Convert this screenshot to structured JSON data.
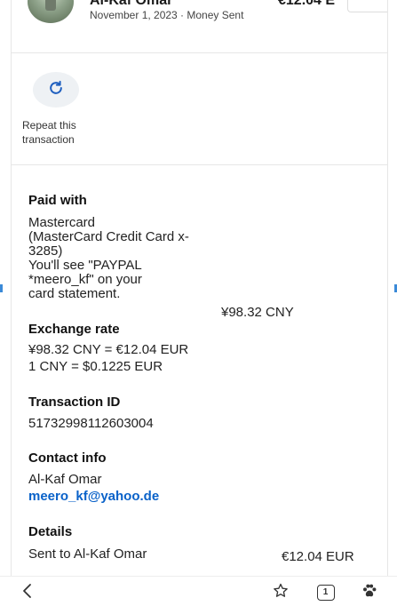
{
  "header": {
    "name": "Al-Kaf Omar",
    "amount": "€12.04 E",
    "subtitle": "November 1, 2023 · Money Sent"
  },
  "repeat": {
    "label": "Repeat this transaction",
    "icon": "refresh-icon"
  },
  "paid_with": {
    "title": "Paid with",
    "line1": "Mastercard",
    "line2": "(MasterCard Credit Card x-",
    "line3": "3285)",
    "line4": "You'll see \"PAYPAL",
    "line5": "*meero_kf\" on your",
    "line6": "card statement.",
    "amount": "¥98.32 CNY"
  },
  "exchange": {
    "title": "Exchange rate",
    "line1": "¥98.32 CNY = €12.04 EUR",
    "line2": "1 CNY = $0.1225 EUR"
  },
  "transaction": {
    "title": "Transaction ID",
    "id": "51732998112603004"
  },
  "contact": {
    "title": "Contact info",
    "name": "Al-Kaf Omar",
    "email": "meero_kf@yahoo.de"
  },
  "details": {
    "title": "Details",
    "label": "Sent to Al-Kaf Omar",
    "amount": "€12.04 EUR"
  },
  "bottom_nav": {
    "tab_count": "1",
    "icons": [
      "back-chevron-icon",
      "star-icon",
      "tabs-icon",
      "paw-icon"
    ]
  },
  "colors": {
    "link": "#0a62c9",
    "icon_blue": "#1f5fbf",
    "repeat_bg": "#eef1f4"
  }
}
